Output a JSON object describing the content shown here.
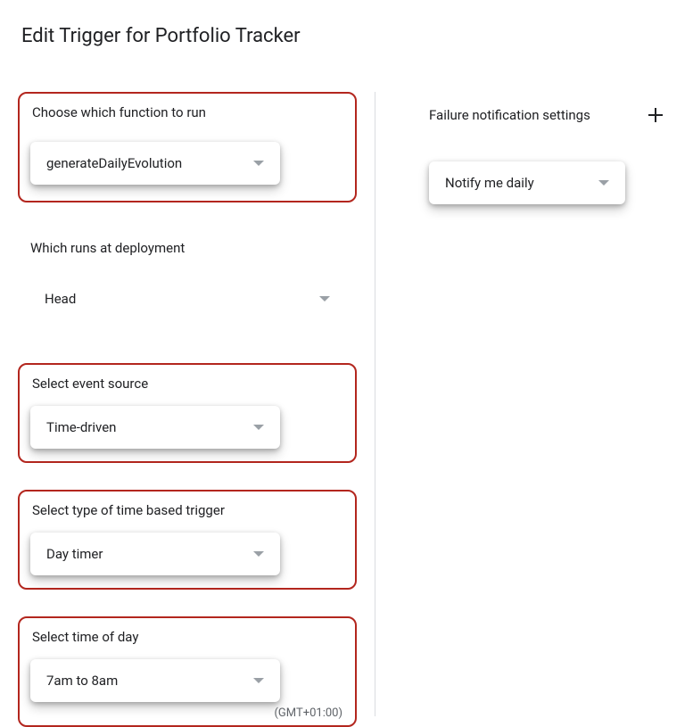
{
  "title": "Edit Trigger for Portfolio Tracker",
  "left": {
    "function": {
      "label": "Choose which function to run",
      "value": "generateDailyEvolution"
    },
    "deployment": {
      "label": "Which runs at deployment",
      "value": "Head"
    },
    "eventSource": {
      "label": "Select event source",
      "value": "Time-driven"
    },
    "triggerType": {
      "label": "Select type of time based trigger",
      "value": "Day timer"
    },
    "timeOfDay": {
      "label": "Select time of day",
      "value": "7am to 8am",
      "timezone": "(GMT+01:00)"
    }
  },
  "right": {
    "headerLabel": "Failure notification settings",
    "notify": {
      "value": "Notify me daily"
    }
  }
}
